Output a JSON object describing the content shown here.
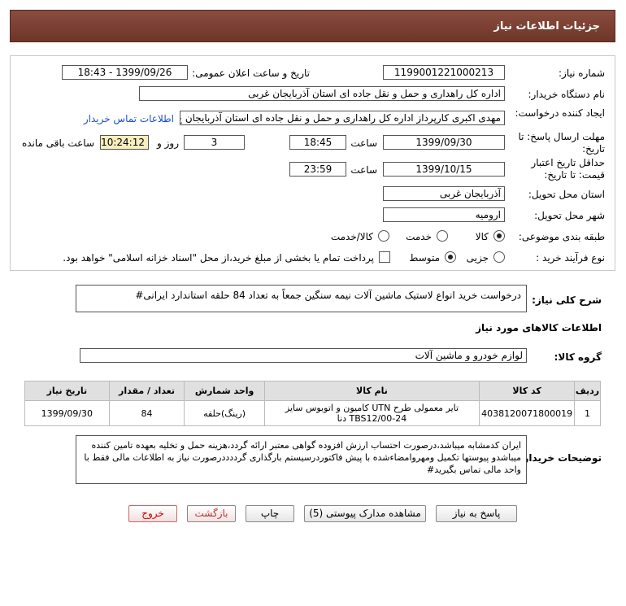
{
  "header": {
    "title": "جزئیات اطلاعات نیاز"
  },
  "form": {
    "need_number_label": "شماره نیاز:",
    "need_number": "1199001221000213",
    "announce_label": "تاریخ و ساعت اعلان عمومی:",
    "announce_value": "1399/09/26 - 18:43",
    "buyer_label": "نام دستگاه خریدار:",
    "buyer_value": "اداره کل راهداری و حمل و نقل جاده ای استان آذربایجان غربی",
    "creator_label": "ایجاد کننده درخواست:",
    "creator_value": "مهدی اکبری کارپرداز اداره کل راهداری و حمل و نقل جاده ای استان آذربایجان غ",
    "contact_link": "اطلاعات تماس خریدار",
    "deadline_label": "مهلت ارسال پاسخ: تا تاریخ:",
    "deadline_date": "1399/09/30",
    "time_label": "ساعت",
    "deadline_time": "18:45",
    "days_value": "3",
    "days_label": "روز و",
    "remaining_time": "10:24:12",
    "remaining_label": "ساعت باقی مانده",
    "validity_label": "حداقل تاریخ اعتبار قیمت: تا تاریخ:",
    "validity_date": "1399/10/15",
    "validity_time": "23:59",
    "province_label": "استان محل تحویل:",
    "province_value": "آذربایجان غربی",
    "city_label": "شهر محل تحویل:",
    "city_value": "ارومیه",
    "category_label": "طبقه بندی موضوعی:",
    "category_options": [
      "کالا",
      "خدمت",
      "کالا/خدمت"
    ],
    "process_label": "نوع فرآیند خرید :",
    "process_options": [
      "جزیی",
      "متوسط"
    ],
    "payment_note": "پرداخت تمام یا بخشی از مبلغ خرید،از محل \"اسناد خزانه اسلامی\" خواهد بود."
  },
  "description": {
    "label": "شرح کلی نیاز:",
    "text": "درخواست خرید انواع لاستیک ماشین آلات نیمه سنگین جمعاً به تعداد 84 حلقه استاندارد ایرانی#"
  },
  "goods": {
    "section_title": "اطلاعات کالاهای مورد نیاز",
    "group_label": "گروه کالا:",
    "group_value": "لوازم خودرو و ماشین آلات",
    "columns": [
      "ردیف",
      "کد کالا",
      "نام کالا",
      "واحد شمارش",
      "تعداد / مقدار",
      "تاریخ نیاز"
    ],
    "rows": [
      {
        "index": "1",
        "code": "4038120071800019",
        "name": "تایر معمولی طرح UTN کامیون و اتوبوس سایز TBS12/00-24 دنا",
        "unit": "(رینگ)حلقه",
        "qty": "84",
        "date": "1399/09/30"
      }
    ]
  },
  "buyer_notes": {
    "label": "توضیحات خریدار:",
    "text": "ایران کدمشابه میباشد،درصورت احتساب ارزش افزوده گواهی معتبر ارائه گردد،هزینه حمل و تخلیه بعهده تامین کننده میباشدو پیوستها تکمیل ومهروامضاءشده با پیش فاکتوردرسیستم بارگذاری گرددددرصورت نیاز به اطلاعات مالی فقط با واحد مالی تماس بگیرید#"
  },
  "buttons": {
    "reply": "پاسخ به نیاز",
    "attachments": "مشاهده مدارک پیوستی (5)",
    "print": "چاپ",
    "back": "بازگشت",
    "exit": "خروج"
  },
  "colors": {
    "header": "#7a3e31",
    "link": "#1a4fd0",
    "highlight": "#f7eebd"
  }
}
